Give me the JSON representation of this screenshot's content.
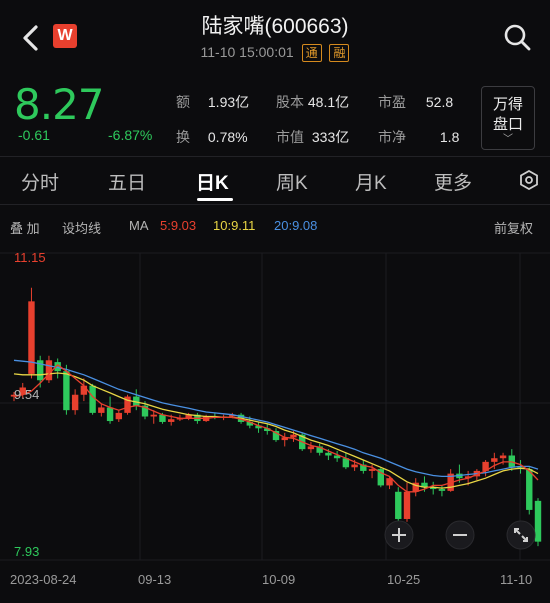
{
  "header": {
    "back_icon": "chevron-left-icon",
    "logo_text": "W",
    "title": "陆家嘴(600663)",
    "datetime": "11-10 15:00:01",
    "tags": [
      "通",
      "融"
    ],
    "search_icon": "search-icon"
  },
  "quote": {
    "price": "8.27",
    "change": "-0.61",
    "change_pct": "-6.87%",
    "stats": [
      {
        "k": "额",
        "v": "1.93亿"
      },
      {
        "k": "股本",
        "v": "48.1亿"
      },
      {
        "k": "市盈",
        "v": "52.8"
      },
      {
        "k": "换",
        "v": "0.78%"
      },
      {
        "k": "市值",
        "v": "333亿"
      },
      {
        "k": "市净",
        "v": "1.8"
      }
    ],
    "wan_label_1": "万得",
    "wan_label_2": "盘口",
    "color_down": "#2ec95c",
    "color_up": "#e8402e"
  },
  "tabs": {
    "items": [
      "分时",
      "五日",
      "日K",
      "周K",
      "月K",
      "更多"
    ],
    "active": "日K",
    "settings_icon": "settings-icon"
  },
  "indicators": {
    "overlay": "叠 加",
    "set_ma": "设均线",
    "ma_label": "MA",
    "ma5": "5:9.03",
    "ma10": "10:9.11",
    "ma20": "20:9.08",
    "adjust": "前复权",
    "ma5_color": "#e8402e",
    "ma10_color": "#e8d545",
    "ma20_color": "#4a90e2"
  },
  "chart_data": {
    "type": "candlestick",
    "y_high_label": "11.15",
    "y_mid_label": "9.54",
    "y_low_label": "7.93",
    "ylim": [
      7.93,
      11.15
    ],
    "x_labels": [
      "2023-08-24",
      "09-13",
      "10-09",
      "10-25",
      "11-10"
    ],
    "ohlc": [
      [
        9.6,
        9.65,
        9.55,
        9.62
      ],
      [
        9.62,
        9.75,
        9.58,
        9.7
      ],
      [
        9.85,
        10.8,
        9.8,
        10.65
      ],
      [
        10.0,
        10.05,
        9.7,
        9.78
      ],
      [
        9.78,
        10.05,
        9.75,
        10.0
      ],
      [
        9.98,
        10.02,
        9.8,
        9.88
      ],
      [
        9.88,
        9.95,
        9.4,
        9.45
      ],
      [
        9.45,
        9.68,
        9.4,
        9.62
      ],
      [
        9.62,
        9.8,
        9.55,
        9.72
      ],
      [
        9.72,
        9.74,
        9.4,
        9.42
      ],
      [
        9.42,
        9.52,
        9.38,
        9.48
      ],
      [
        9.48,
        9.6,
        9.3,
        9.33
      ],
      [
        9.35,
        9.45,
        9.32,
        9.42
      ],
      [
        9.42,
        9.62,
        9.4,
        9.6
      ],
      [
        9.6,
        9.68,
        9.45,
        9.5
      ],
      [
        9.5,
        9.55,
        9.35,
        9.38
      ],
      [
        9.38,
        9.45,
        9.3,
        9.4
      ],
      [
        9.4,
        9.42,
        9.3,
        9.32
      ],
      [
        9.32,
        9.4,
        9.28,
        9.35
      ],
      [
        9.35,
        9.4,
        9.33,
        9.36
      ],
      [
        9.36,
        9.42,
        9.34,
        9.4
      ],
      [
        9.4,
        9.42,
        9.3,
        9.33
      ],
      [
        9.33,
        9.4,
        9.32,
        9.38
      ],
      [
        9.38,
        9.42,
        9.35,
        9.37
      ],
      [
        9.37,
        9.4,
        9.34,
        9.38
      ],
      [
        9.38,
        9.42,
        9.36,
        9.4
      ],
      [
        9.4,
        9.42,
        9.3,
        9.32
      ],
      [
        9.32,
        9.38,
        9.25,
        9.28
      ],
      [
        9.28,
        9.32,
        9.2,
        9.25
      ],
      [
        9.25,
        9.3,
        9.18,
        9.22
      ],
      [
        9.22,
        9.25,
        9.1,
        9.12
      ],
      [
        9.12,
        9.2,
        9.05,
        9.15
      ],
      [
        9.15,
        9.22,
        9.1,
        9.18
      ],
      [
        9.18,
        9.2,
        9.0,
        9.02
      ],
      [
        9.02,
        9.1,
        8.98,
        9.05
      ],
      [
        9.05,
        9.08,
        8.95,
        8.98
      ],
      [
        8.98,
        9.02,
        8.9,
        8.95
      ],
      [
        8.95,
        9.0,
        8.88,
        8.92
      ],
      [
        8.92,
        8.98,
        8.8,
        8.82
      ],
      [
        8.82,
        8.9,
        8.78,
        8.85
      ],
      [
        8.85,
        8.9,
        8.75,
        8.78
      ],
      [
        8.78,
        8.85,
        8.7,
        8.8
      ],
      [
        8.8,
        8.82,
        8.6,
        8.62
      ],
      [
        8.62,
        8.72,
        8.58,
        8.7
      ],
      [
        8.55,
        8.6,
        8.2,
        8.25
      ],
      [
        8.25,
        8.65,
        8.22,
        8.55
      ],
      [
        8.55,
        8.7,
        8.5,
        8.65
      ],
      [
        8.65,
        8.72,
        8.55,
        8.6
      ],
      [
        8.6,
        8.66,
        8.52,
        8.58
      ],
      [
        8.58,
        8.62,
        8.5,
        8.56
      ],
      [
        8.56,
        8.8,
        8.55,
        8.75
      ],
      [
        8.75,
        8.85,
        8.65,
        8.7
      ],
      [
        8.7,
        8.78,
        8.62,
        8.72
      ],
      [
        8.72,
        8.8,
        8.68,
        8.78
      ],
      [
        8.78,
        8.9,
        8.72,
        8.88
      ],
      [
        8.88,
        8.98,
        8.8,
        8.92
      ],
      [
        8.92,
        8.98,
        8.85,
        8.95
      ],
      [
        8.95,
        9.02,
        8.78,
        8.82
      ],
      [
        8.82,
        8.9,
        8.75,
        8.8
      ],
      [
        8.8,
        8.82,
        8.3,
        8.35
      ],
      [
        8.45,
        8.48,
        7.95,
        8.0
      ]
    ],
    "ma5": [
      9.6,
      9.62,
      9.66,
      9.75,
      9.85,
      9.95,
      9.88,
      9.8,
      9.72,
      9.6,
      9.52,
      9.48,
      9.45,
      9.48,
      9.5,
      9.48,
      9.44,
      9.4,
      9.38,
      9.36,
      9.36,
      9.36,
      9.36,
      9.37,
      9.37,
      9.37,
      9.35,
      9.32,
      9.28,
      9.25,
      9.2,
      9.15,
      9.14,
      9.1,
      9.06,
      9.04,
      9.0,
      8.96,
      8.92,
      8.88,
      8.84,
      8.82,
      8.76,
      8.72,
      8.62,
      8.55,
      8.55,
      8.58,
      8.62,
      8.62,
      8.65,
      8.68,
      8.7,
      8.74,
      8.78,
      8.84,
      8.88,
      8.88,
      8.85,
      8.78,
      8.68
    ],
    "ma10": [
      9.85,
      9.84,
      9.84,
      9.84,
      9.85,
      9.86,
      9.85,
      9.82,
      9.78,
      9.72,
      9.68,
      9.64,
      9.6,
      9.56,
      9.54,
      9.52,
      9.49,
      9.46,
      9.44,
      9.42,
      9.4,
      9.39,
      9.38,
      9.38,
      9.37,
      9.37,
      9.36,
      9.34,
      9.32,
      9.3,
      9.27,
      9.23,
      9.2,
      9.16,
      9.12,
      9.09,
      9.06,
      9.02,
      8.98,
      8.94,
      8.9,
      8.86,
      8.82,
      8.78,
      8.72,
      8.66,
      8.62,
      8.6,
      8.6,
      8.59,
      8.6,
      8.62,
      8.64,
      8.67,
      8.7,
      8.74,
      8.78,
      8.8,
      8.81,
      8.8,
      8.75
    ],
    "ma20": [
      10.0,
      9.99,
      9.98,
      9.96,
      9.94,
      9.92,
      9.9,
      9.87,
      9.84,
      9.8,
      9.76,
      9.72,
      9.68,
      9.65,
      9.62,
      9.59,
      9.56,
      9.53,
      9.51,
      9.49,
      9.47,
      9.45,
      9.43,
      9.42,
      9.41,
      9.4,
      9.38,
      9.36,
      9.34,
      9.32,
      9.29,
      9.26,
      9.23,
      9.2,
      9.17,
      9.14,
      9.11,
      9.08,
      9.05,
      9.02,
      8.98,
      8.95,
      8.92,
      8.88,
      8.84,
      8.8,
      8.77,
      8.75,
      8.73,
      8.72,
      8.72,
      8.73,
      8.74,
      8.75,
      8.76,
      8.78,
      8.8,
      8.82,
      8.83,
      8.83,
      8.8
    ],
    "controls": {
      "zoom_in": "+",
      "zoom_out": "−",
      "fullscreen_icon": "expand-icon"
    }
  }
}
